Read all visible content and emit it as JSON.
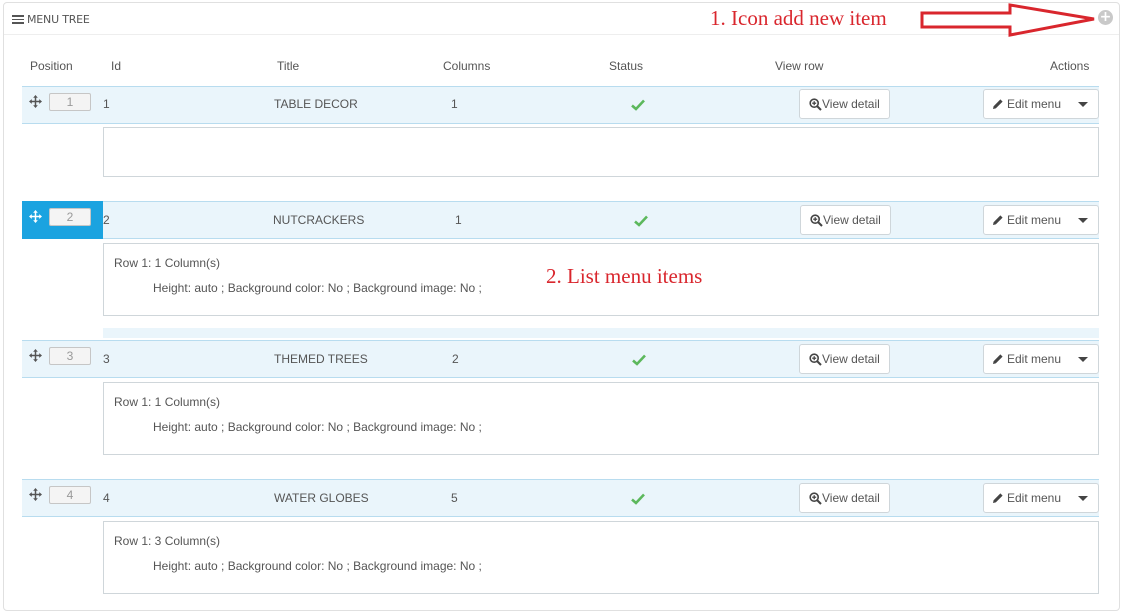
{
  "panel": {
    "title": "MENU TREE"
  },
  "annotations": {
    "add_item": "1. Icon add new item",
    "list_items": "2. List menu items"
  },
  "columns": [
    "Position",
    "Id",
    "Title",
    "Columns",
    "Status",
    "View row",
    "Actions"
  ],
  "rows": [
    {
      "position": "1",
      "id": "1",
      "title": "TABLE DECOR",
      "columns": "1",
      "status": "enabled",
      "view_label": "View detail",
      "edit_label": "Edit menu",
      "detail_row": "",
      "detail_props": ""
    },
    {
      "position": "2",
      "id": "2",
      "title": "NUTCRACKERS",
      "columns": "1",
      "status": "enabled",
      "view_label": "View detail",
      "edit_label": "Edit menu",
      "detail_row": "Row 1: 1 Column(s)",
      "detail_props": "Height: auto ; Background color: No ; Background image: No ;"
    },
    {
      "position": "3",
      "id": "3",
      "title": "THEMED TREES",
      "columns": "2",
      "status": "enabled",
      "view_label": "View detail",
      "edit_label": "Edit menu",
      "detail_row": "Row 1: 1 Column(s)",
      "detail_props": "Height: auto ; Background color: No ; Background image: No ;"
    },
    {
      "position": "4",
      "id": "4",
      "title": "WATER GLOBES",
      "columns": "5",
      "status": "enabled",
      "view_label": "View detail",
      "edit_label": "Edit menu",
      "detail_row": "Row 1: 3 Column(s)",
      "detail_props": "Height: auto ; Background color: No ; Background image: No ;"
    }
  ],
  "colors": {
    "accent": "#1ba3e0",
    "row_band": "#eaf5fb",
    "status_ok": "#5cb85c",
    "annotation": "#d9262d"
  }
}
